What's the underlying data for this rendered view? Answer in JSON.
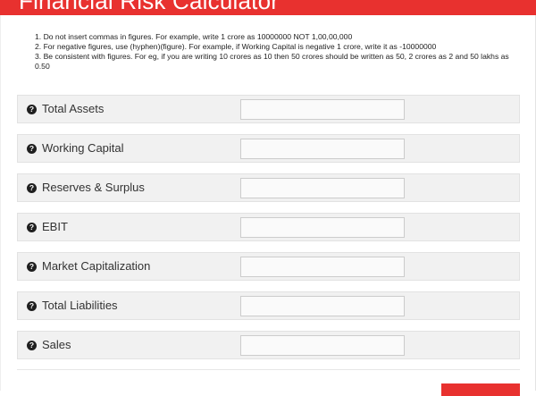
{
  "header": {
    "title": "Financial Risk Calculator"
  },
  "colors": {
    "accent": "#e8312f",
    "row_background": "#f1f1f1"
  },
  "instructions": [
    {
      "num": "1.",
      "text": "Do not insert commas in figures. For example, write 1 crore as 10000000 NOT 1,00,00,000"
    },
    {
      "num": "2.",
      "text": "For negative figures, use (hyphen)(figure). For example, if Working Capital is negative 1 crore, write it as -10000000"
    },
    {
      "num": "3.",
      "text": "Be consistent with figures. For eg, if you are writing 10 crores as 10 then 50 crores should be written as 50, 2 crores as 2 and 50 lakhs as 0.50"
    }
  ],
  "fields": [
    {
      "label": "Total Assets",
      "value": "",
      "icon": "question-circle-icon"
    },
    {
      "label": "Working Capital",
      "value": "",
      "icon": "question-circle-icon"
    },
    {
      "label": "Reserves & Surplus",
      "value": "",
      "icon": "question-circle-icon"
    },
    {
      "label": "EBIT",
      "value": "",
      "icon": "question-circle-icon"
    },
    {
      "label": "Market Capitalization",
      "value": "",
      "icon": "question-circle-icon"
    },
    {
      "label": "Total Liabilities",
      "value": "",
      "icon": "question-circle-icon"
    },
    {
      "label": "Sales",
      "value": "",
      "icon": "question-circle-icon"
    }
  ],
  "icon_glyph": "?"
}
